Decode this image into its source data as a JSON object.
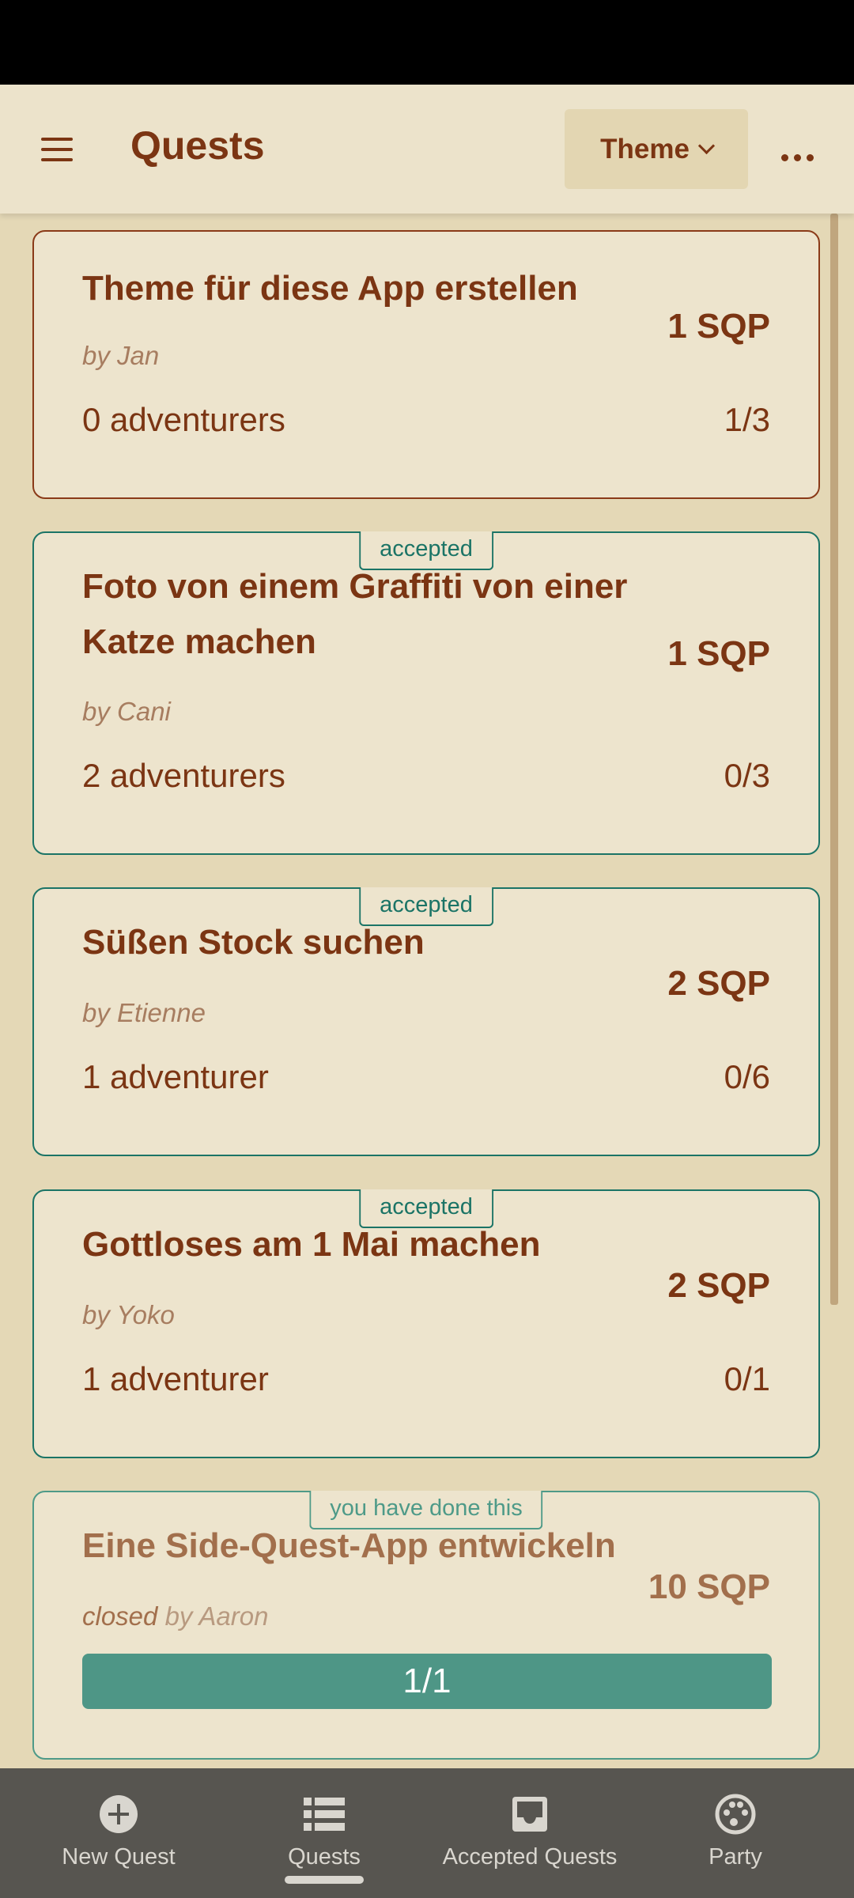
{
  "app_bar": {
    "title": "Quests",
    "theme_label": "Theme",
    "menu_icon": "hamburger-menu-icon",
    "more_icon": "more-horizontal-icon"
  },
  "quests": [
    {
      "title": "Theme für diese App erstellen",
      "sqp": "1 SQP",
      "author": "by Jan",
      "adventurers": "0 adventurers",
      "count": "1/3"
    },
    {
      "badge": "accepted",
      "title_line1": "Foto von einem Graffiti von einer",
      "title_line2": "Katze machen",
      "sqp": "1 SQP",
      "author": "by Cani",
      "adventurers": "2 adventurers",
      "count": "0/3"
    },
    {
      "badge": "accepted",
      "title": "Süßen Stock suchen",
      "sqp": "2 SQP",
      "author": "by Etienne",
      "adventurers": "1 adventurer",
      "count": "0/6"
    },
    {
      "badge": "accepted",
      "title": "Gottloses am 1 Mai machen",
      "sqp": "2 SQP",
      "author": "by Yoko",
      "adventurers": "1 adventurer",
      "count": "0/1"
    },
    {
      "badge": "you have done this",
      "title": "Eine Side-Quest-App entwickeln",
      "sqp": "10 SQP",
      "closed": "closed",
      "author": "by Aaron",
      "progress": "1/1"
    }
  ],
  "bottom_nav": {
    "items": [
      {
        "label": "New Quest",
        "icon": "add-circle-icon"
      },
      {
        "label": "Quests",
        "icon": "list-icon",
        "active": true
      },
      {
        "label": "Accepted Quests",
        "icon": "inbox-icon"
      },
      {
        "label": "Party",
        "icon": "palette-icon"
      }
    ]
  },
  "colors": {
    "primary": "#7b3513",
    "accent": "#1b7466",
    "card_bg": "#ede4cd",
    "page_bg": "#e4d8b6",
    "nav_bg": "#575550"
  }
}
